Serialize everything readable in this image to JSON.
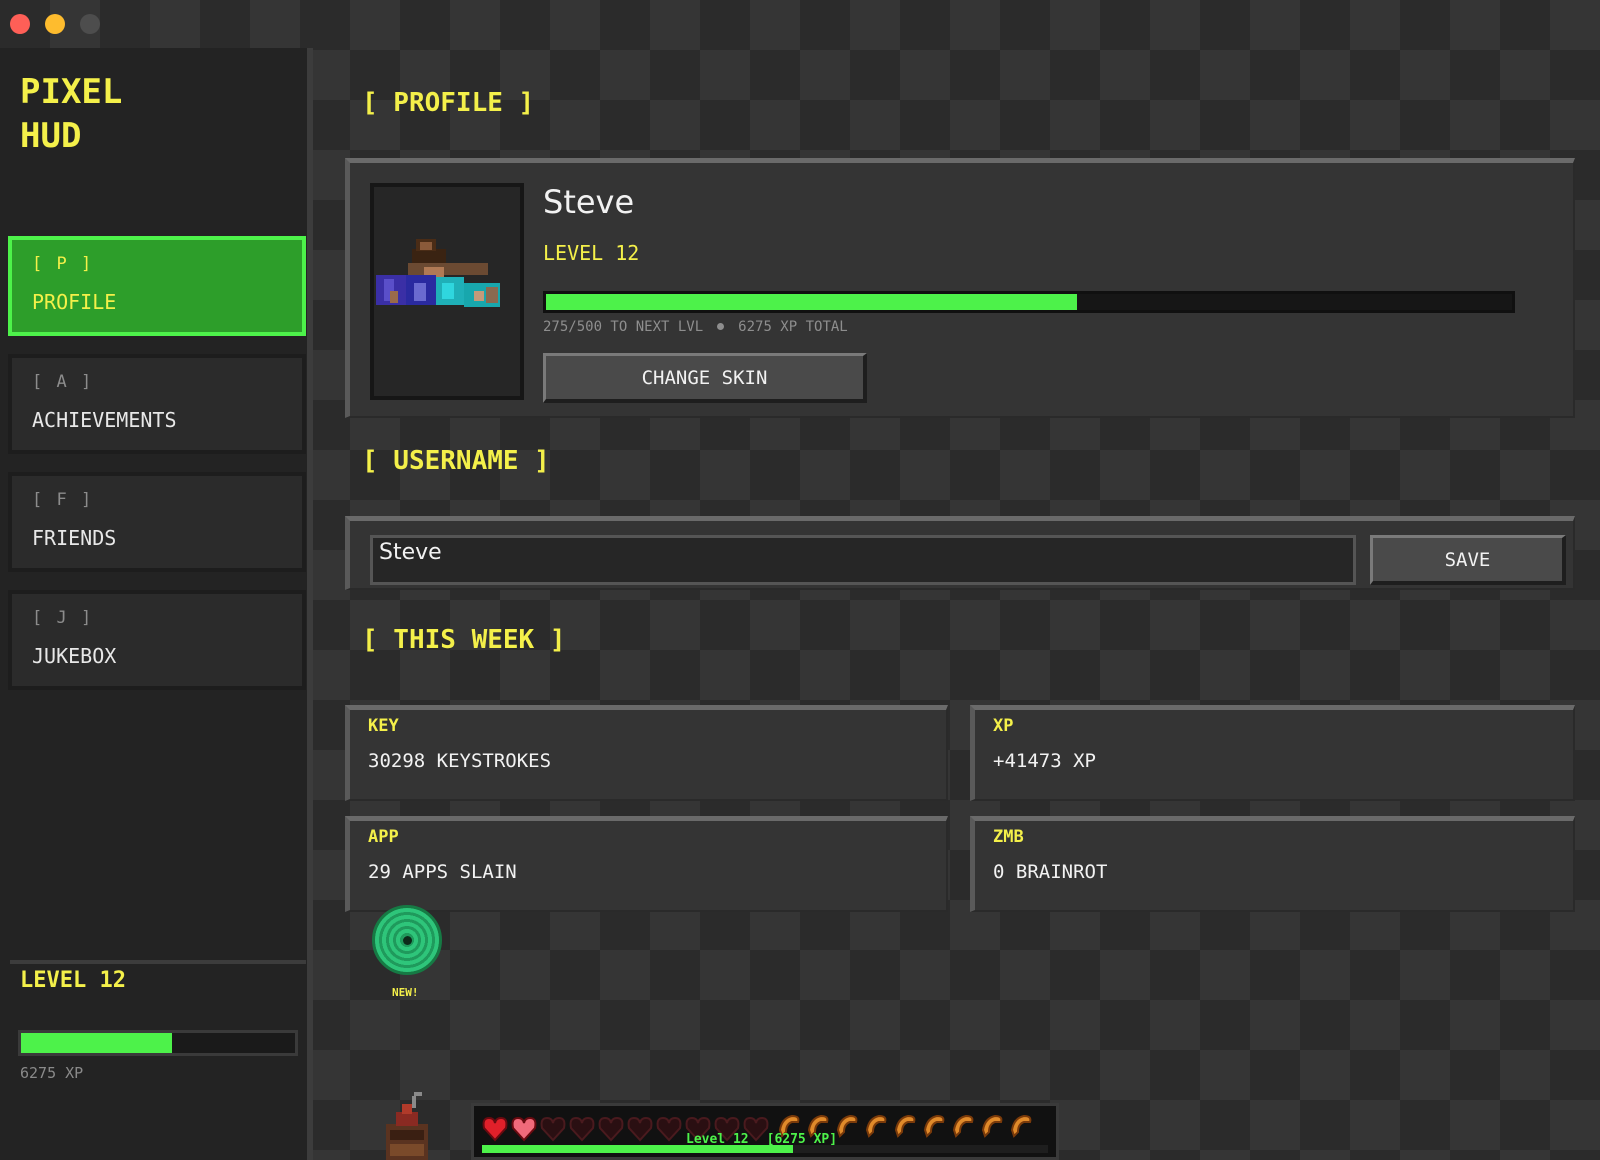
{
  "brand": {
    "line1": "PIXEL",
    "line2": "HUD"
  },
  "nav": [
    {
      "key": "[ P ]",
      "label": "PROFILE"
    },
    {
      "key": "[ A ]",
      "label": "ACHIEVEMENTS"
    },
    {
      "key": "[ F ]",
      "label": "FRIENDS"
    },
    {
      "key": "[ J ]",
      "label": "JUKEBOX"
    }
  ],
  "sidebar_footer": {
    "level": "LEVEL 12",
    "xp": "6275 XP",
    "progress": 0.55
  },
  "profile": {
    "section_title": "[ PROFILE ]",
    "name": "Steve",
    "level": "LEVEL 12",
    "progress_text": "275/500 TO NEXT LVL",
    "total_text": "6275 XP TOTAL",
    "progress": 0.55,
    "change_skin": "CHANGE SKIN"
  },
  "username": {
    "section_title": "[ USERNAME ]",
    "value": "Steve",
    "save": "SAVE"
  },
  "week": {
    "section_title": "[ THIS WEEK ]",
    "stats": [
      {
        "tag": "KEY",
        "value": "30298 KEYSTROKES"
      },
      {
        "tag": "XP",
        "value": "+41473 XP"
      },
      {
        "tag": "APP",
        "value": "29 APPS SLAIN"
      },
      {
        "tag": "ZMB",
        "value": "0 BRAINROT"
      }
    ]
  },
  "disc": {
    "badge": "NEW!"
  },
  "hotbar": {
    "level": "Level 12",
    "xp": "[6275 XP]",
    "hearts_full": 2,
    "hearts_total": 10,
    "food": 9,
    "progress": 0.55
  },
  "colors": {
    "accent_yellow": "#f4f04a",
    "accent_green": "#4df24a",
    "active_bg": "#2d9e2a"
  }
}
